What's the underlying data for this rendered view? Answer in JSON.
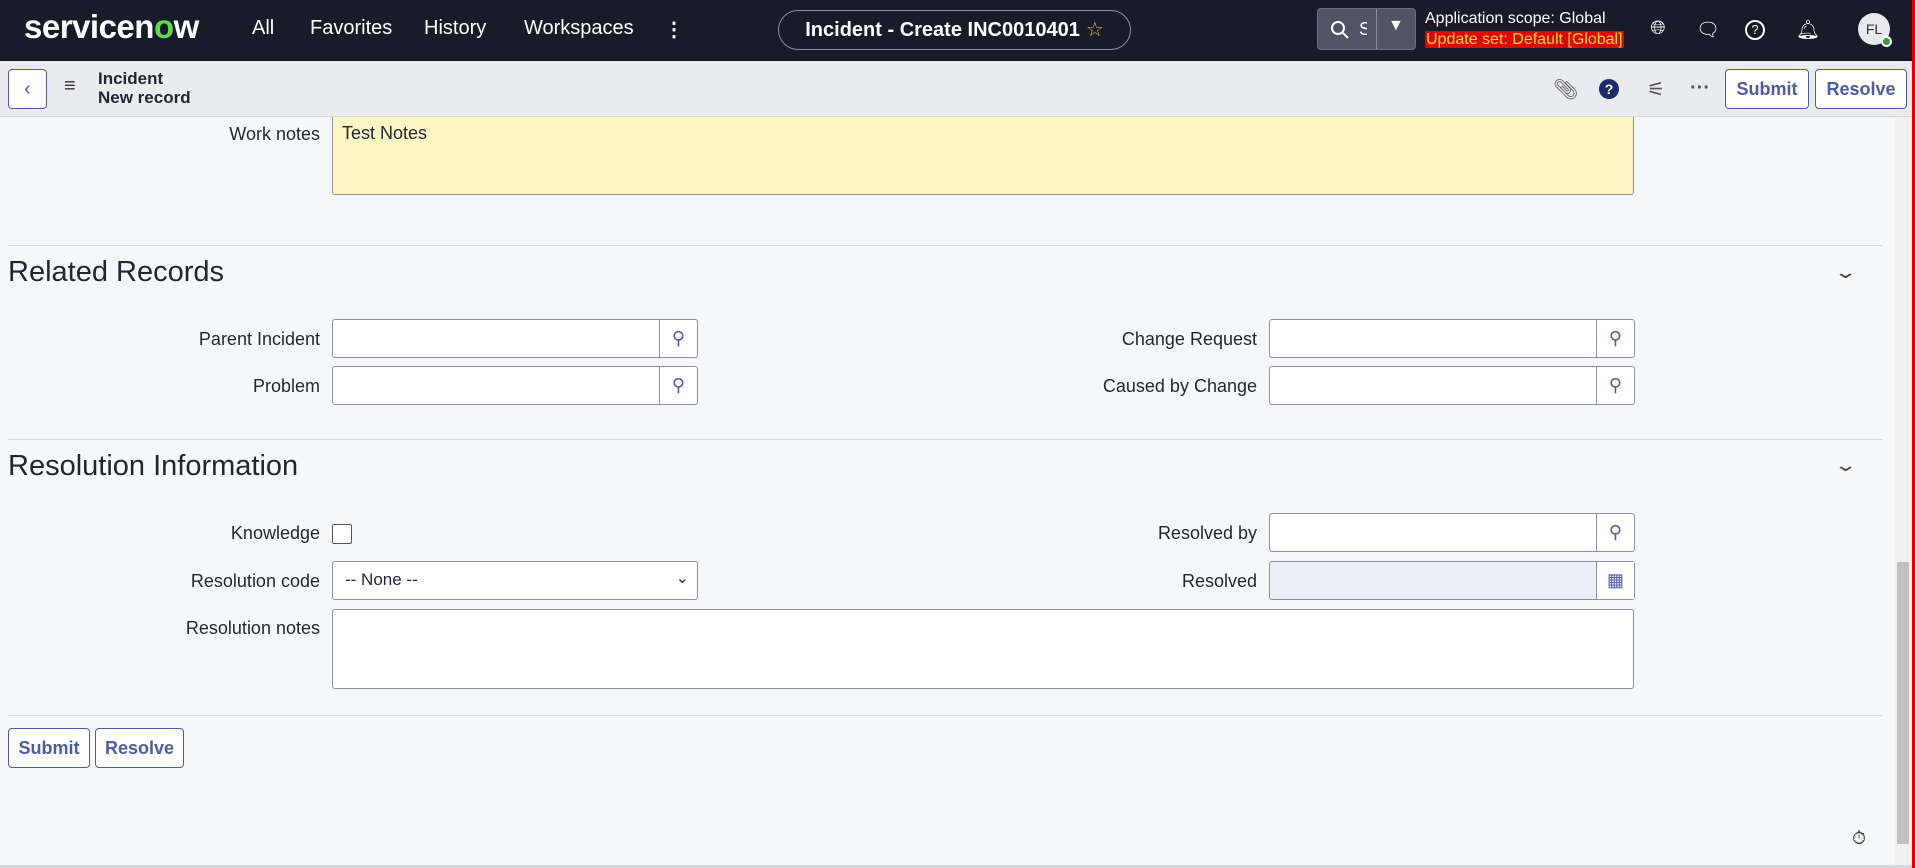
{
  "header": {
    "logo": "servicenow",
    "nav": [
      "All",
      "Favorites",
      "History",
      "Workspaces"
    ],
    "title": "Incident - Create INC0010401",
    "search_text": "S",
    "scope": "Application scope: Global",
    "update_set": "Update set: Default [Global]",
    "avatar_initials": "FL"
  },
  "record": {
    "table": "Incident",
    "subtitle": "New record",
    "submit_label": "Submit",
    "resolve_label": "Resolve"
  },
  "form": {
    "work_notes_label": "Work notes",
    "work_notes_value": "Test Notes",
    "related": {
      "title": "Related Records",
      "parent_incident": "Parent Incident",
      "problem": "Problem",
      "change_request": "Change Request",
      "caused_by_change": "Caused by Change"
    },
    "resolution": {
      "title": "Resolution Information",
      "knowledge": "Knowledge",
      "knowledge_checked": false,
      "resolution_code": "Resolution code",
      "resolution_code_value": "-- None --",
      "resolution_notes": "Resolution notes",
      "resolved_by": "Resolved by",
      "resolved": "Resolved"
    },
    "submit_label": "Submit",
    "resolve_label": "Resolve"
  },
  "colors": {
    "header_bg": "#171b2a",
    "accent": "#4e5ba6",
    "work_notes_bg": "#fdf6c3",
    "update_set_bg": "#e00000",
    "update_set_fg": "#ffe100"
  }
}
